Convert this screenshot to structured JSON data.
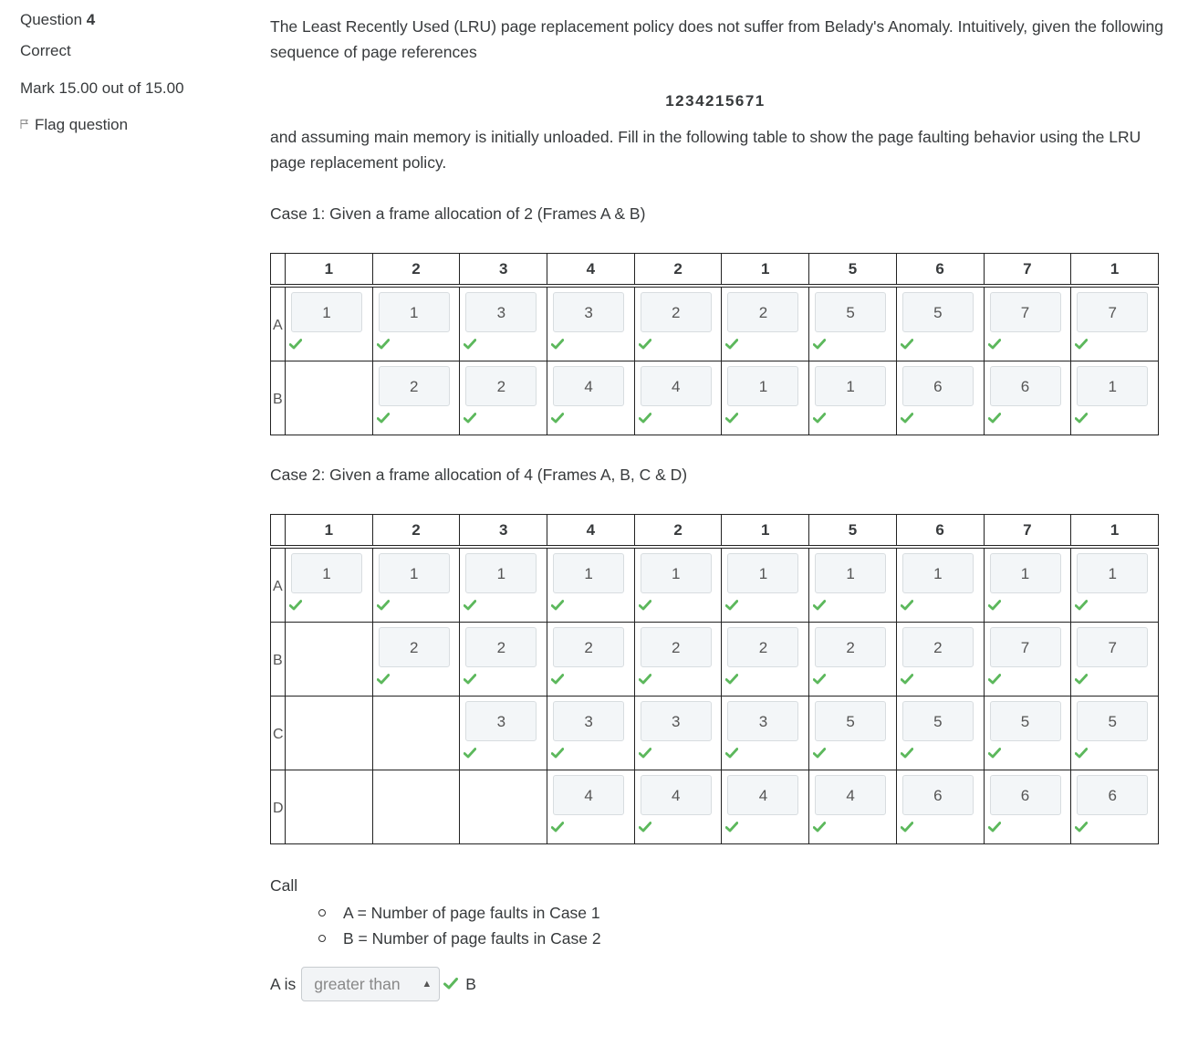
{
  "sidebar": {
    "question_label": "Question",
    "question_number": "4",
    "state": "Correct",
    "grade": "Mark 15.00 out of 15.00",
    "flag_label": "Flag question"
  },
  "question": {
    "intro": "The Least Recently Used (LRU) page replacement policy does not suffer from Belady's Anomaly. Intuitively, given the following sequence of page references",
    "sequence": "1234215671",
    "instructions": "and assuming main memory is initially unloaded. Fill in the following table to show the page faulting behavior using the LRU page replacement policy.",
    "case1_label": "Case 1: Given a frame allocation of 2 (Frames A & B)",
    "case2_label": "Case 2: Given a frame allocation of 4 (Frames A, B, C & D)",
    "headers": [
      "1",
      "2",
      "3",
      "4",
      "2",
      "1",
      "5",
      "6",
      "7",
      "1"
    ],
    "case1": {
      "frames": [
        "A",
        "B"
      ],
      "values": [
        [
          "1",
          "1",
          "3",
          "3",
          "2",
          "2",
          "5",
          "5",
          "7",
          "7"
        ],
        [
          "",
          "2",
          "2",
          "4",
          "4",
          "1",
          "1",
          "6",
          "6",
          "1"
        ]
      ]
    },
    "case2": {
      "frames": [
        "A",
        "B",
        "C",
        "D"
      ],
      "values": [
        [
          "1",
          "1",
          "1",
          "1",
          "1",
          "1",
          "1",
          "1",
          "1",
          "1"
        ],
        [
          "",
          "2",
          "2",
          "2",
          "2",
          "2",
          "2",
          "2",
          "7",
          "7"
        ],
        [
          "",
          "",
          "3",
          "3",
          "3",
          "3",
          "5",
          "5",
          "5",
          "5"
        ],
        [
          "",
          "",
          "",
          "4",
          "4",
          "4",
          "4",
          "6",
          "6",
          "6"
        ]
      ]
    },
    "call_label": "Call",
    "definitions": [
      "A = Number of page faults in Case 1",
      "B = Number of page faults in Case 2"
    ],
    "answer_prefix": "A is",
    "answer_selected": "greater than",
    "answer_suffix": "B"
  },
  "colors": {
    "correct_tick": "#5cb85c"
  },
  "icons": {
    "flag": "flag-icon",
    "tick": "check-icon",
    "select": "chevron-updown-icon"
  }
}
